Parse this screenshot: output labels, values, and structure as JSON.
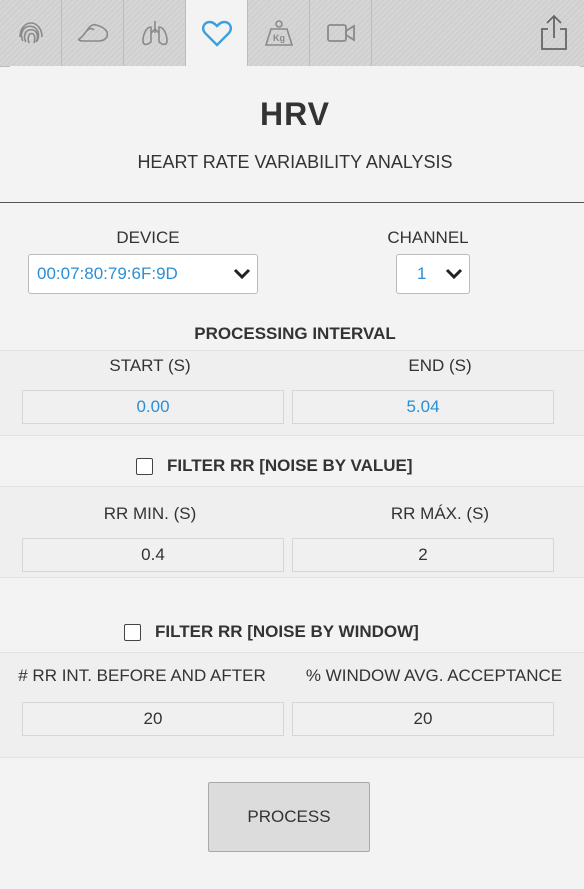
{
  "tabs": [
    {
      "name": "fingerprint-icon"
    },
    {
      "name": "arm-muscle-icon"
    },
    {
      "name": "lungs-icon"
    },
    {
      "name": "heart-icon",
      "active": true
    },
    {
      "name": "weight-kg-icon",
      "text": "Kg"
    },
    {
      "name": "video-camera-icon"
    }
  ],
  "share_icon": "share-icon",
  "header": {
    "title": "HRV",
    "subtitle": "HEART RATE VARIABILITY ANALYSIS"
  },
  "device": {
    "label": "DEVICE",
    "value": "00:07:80:79:6F:9D"
  },
  "channel": {
    "label": "CHANNEL",
    "value": "1"
  },
  "processing": {
    "label": "PROCESSING INTERVAL",
    "start_label": "START (S)",
    "start_value": "0.00",
    "end_label": "END (S)",
    "end_value": "5.04"
  },
  "filter_value": {
    "label": "FILTER RR [NOISE BY VALUE]",
    "min_label": "RR MIN. (S)",
    "min_value": "0.4",
    "max_label": "RR MÁX. (S)",
    "max_value": "2"
  },
  "filter_window": {
    "label": "FILTER RR [NOISE BY WINDOW]",
    "int_label": "# RR INT. BEFORE AND AFTER",
    "int_value": "20",
    "accept_label": "% WINDOW AVG. ACCEPTANCE",
    "accept_value": "20"
  },
  "process_button": "PROCESS",
  "colors": {
    "accent": "#2a8fd6",
    "heart": "#3aa0e0"
  }
}
